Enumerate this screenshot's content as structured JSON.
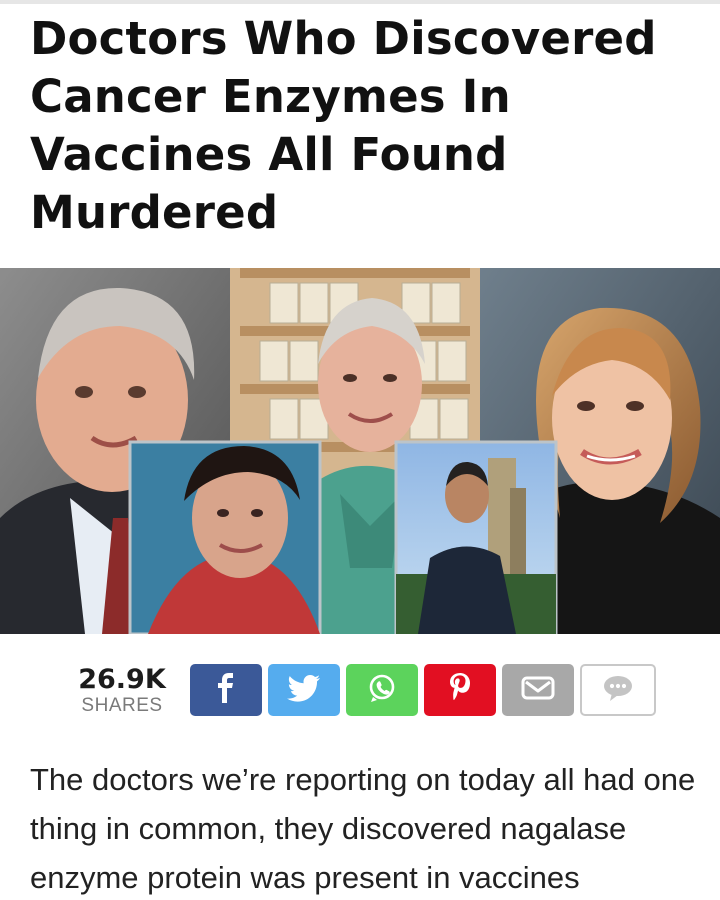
{
  "article": {
    "headline": "Doctors Who Discovered Cancer Enzymes In Vaccines All Found Murdered",
    "body_text": "The doctors we’re reporting on today all had one thing in common, they discovered nagalase enzyme protein was present in vaccines"
  },
  "share": {
    "count": "26.9K",
    "count_label": "SHARES",
    "buttons": [
      {
        "name": "facebook",
        "icon": "facebook-icon",
        "color": "#3b5998"
      },
      {
        "name": "twitter",
        "icon": "twitter-icon",
        "color": "#55acee"
      },
      {
        "name": "whatsapp",
        "icon": "whatsapp-icon",
        "color": "#5cd35c"
      },
      {
        "name": "pinterest",
        "icon": "pinterest-icon",
        "color": "#e20f22"
      },
      {
        "name": "email",
        "icon": "email-icon",
        "color": "#a8a8a8"
      },
      {
        "name": "comment",
        "icon": "comment-icon",
        "color": "#c8c8c8"
      }
    ]
  },
  "colors": {
    "headline": "#111111",
    "body_text": "#222222",
    "share_label": "#7a7a7a"
  }
}
